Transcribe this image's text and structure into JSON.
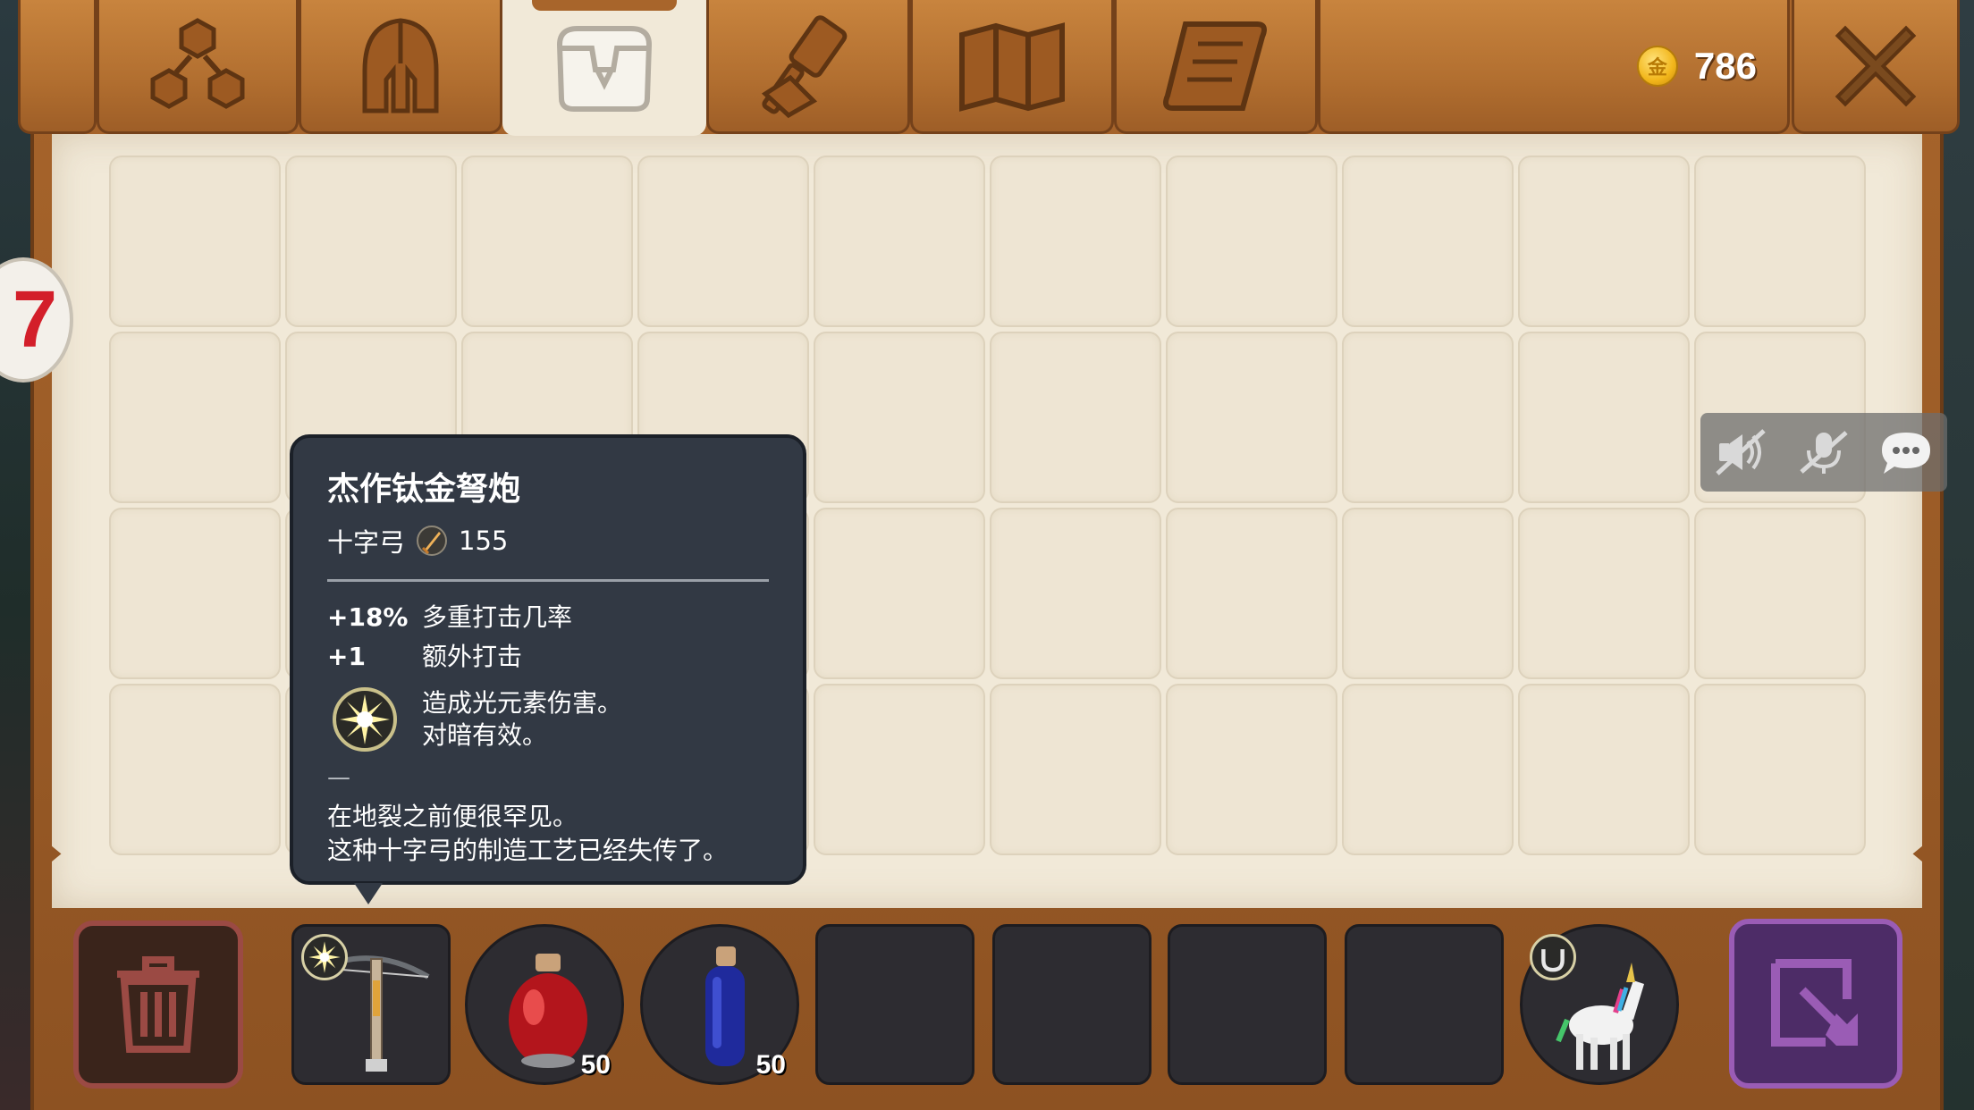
{
  "header": {
    "tabs": [
      {
        "icon": "skill-tree-icon",
        "active": false
      },
      {
        "icon": "helmet-icon",
        "active": false
      },
      {
        "icon": "backpack-icon",
        "active": true
      },
      {
        "icon": "hammer-icon",
        "active": false
      },
      {
        "icon": "map-icon",
        "active": false
      },
      {
        "icon": "scroll-icon",
        "active": false
      }
    ],
    "coin_icon_glyph": "金",
    "coins": "786",
    "close_icon": "close-icon"
  },
  "side_bubble": {
    "text": "7"
  },
  "chat_controls": [
    "mute-voice-icon",
    "mute-mic-icon",
    "chat-icon"
  ],
  "tooltip": {
    "title": "杰作钛金弩炮",
    "item_type": "十字弓",
    "damage": "155",
    "stats": [
      {
        "value": "+18%",
        "label": "多重打击几率"
      },
      {
        "value": "+1",
        "label": "额外打击"
      }
    ],
    "effect_line1": "造成光元素伤害。",
    "effect_line2": "对暗有效。",
    "separator": "—",
    "lore_line1": "在地裂之前便很罕见。",
    "lore_line2": "这种十字弓的制造工艺已经失传了。"
  },
  "hotbar": {
    "trash_icon": "trash-icon",
    "slots": [
      {
        "item": "crossbow",
        "qty": ""
      },
      {
        "item": "health-potion",
        "qty": "50"
      },
      {
        "item": "mana-potion",
        "qty": "50"
      },
      {
        "item": "",
        "qty": ""
      },
      {
        "item": "",
        "qty": ""
      },
      {
        "item": "",
        "qty": ""
      },
      {
        "item": "",
        "qty": ""
      },
      {
        "item": "unicorn-mount",
        "qty": ""
      }
    ],
    "exit_icon": "exit-icon"
  },
  "colors": {
    "wood": "#b26f30",
    "parchment": "#f1e9d8",
    "tooltip_bg": "#323944",
    "trash_border": "#9b4a44",
    "exit_border": "#9a5cb5"
  }
}
